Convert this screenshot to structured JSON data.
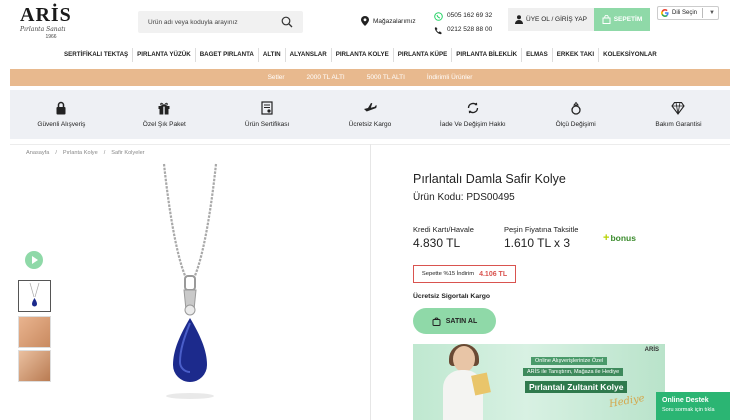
{
  "header": {
    "logo": {
      "brand": "ARİS",
      "tagline": "Pırlanta Sanatı",
      "year": "1966"
    },
    "search": {
      "placeholder": "Ürün adı veya koduyla arayınız"
    },
    "stores_label": "Mağazalarımız",
    "phones": [
      "0505 162 69 32",
      "0212 528 88 00"
    ],
    "login_label": "ÜYE OL / GİRİŞ YAP",
    "cart_label": "SEPETİM",
    "language_label": "Dili Seçin",
    "language_arrow": "▼"
  },
  "nav": [
    "SERTİFİKALI TEKTAŞ",
    "PIRLANTA YÜZÜK",
    "BAGET PIRLANTA",
    "ALTIN",
    "ALYANSLAR",
    "PIRLANTA KOLYE",
    "PIRLANTA KÜPE",
    "PIRLANTA BİLEKLİK",
    "ELMAS",
    "ERKEK TAKI",
    "KOLEKSİYONLAR"
  ],
  "promo": [
    "Setler",
    "2000 TL ALTI",
    "5000 TL ALTI",
    "İndirimli Ürünler"
  ],
  "features": [
    {
      "label": "Güvenli Alışveriş",
      "icon": "lock-icon"
    },
    {
      "label": "Özel Şık Paket",
      "icon": "gift-icon"
    },
    {
      "label": "Ürün Sertifikası",
      "icon": "certificate-icon"
    },
    {
      "label": "Ücretsiz Kargo",
      "icon": "plane-icon"
    },
    {
      "label": "İade Ve Değişim Hakkı",
      "icon": "exchange-icon"
    },
    {
      "label": "Ölçü Değişimi",
      "icon": "ring-icon"
    },
    {
      "label": "Bakım Garantisi",
      "icon": "diamond-icon"
    }
  ],
  "breadcrumb": [
    "Anasayfa",
    "/",
    "Pırlanta Kolye",
    "/",
    "Safir Kolyeler"
  ],
  "product": {
    "title": "Pırlantalı Damla Safir Kolye",
    "code": "Ürün Kodu: PDS00495",
    "credit_label": "Kredi Kartı/Havale",
    "credit_price": "4.830 TL",
    "cash_label": "Peşin Fiyatına Taksitle",
    "cash_price": "1.610 TL x 3",
    "bonus_plus": "+",
    "bonus": "bonus",
    "discount_label": "Sepette %15 İndirim",
    "discount_price": "4.106 TL",
    "shipping": "Ücretsiz Sigortalı Kargo",
    "buy_label": "SATIN AL"
  },
  "banner": {
    "logo": "ARİS",
    "line1": "Online Alışverişlerinize Özel",
    "line2": "ARİS ile Tanıştırın, Mağaza ile Hediye",
    "line3": "Pırlantalı Zultanit Kolye",
    "line4": "Hediye"
  },
  "support": {
    "title": "Online Destek",
    "subtitle": "Soru sormak için tıkla"
  },
  "colors": {
    "accent_green": "#8fd9a8",
    "promo": "#e8b98e",
    "sapphire": "#1c2a8c"
  }
}
